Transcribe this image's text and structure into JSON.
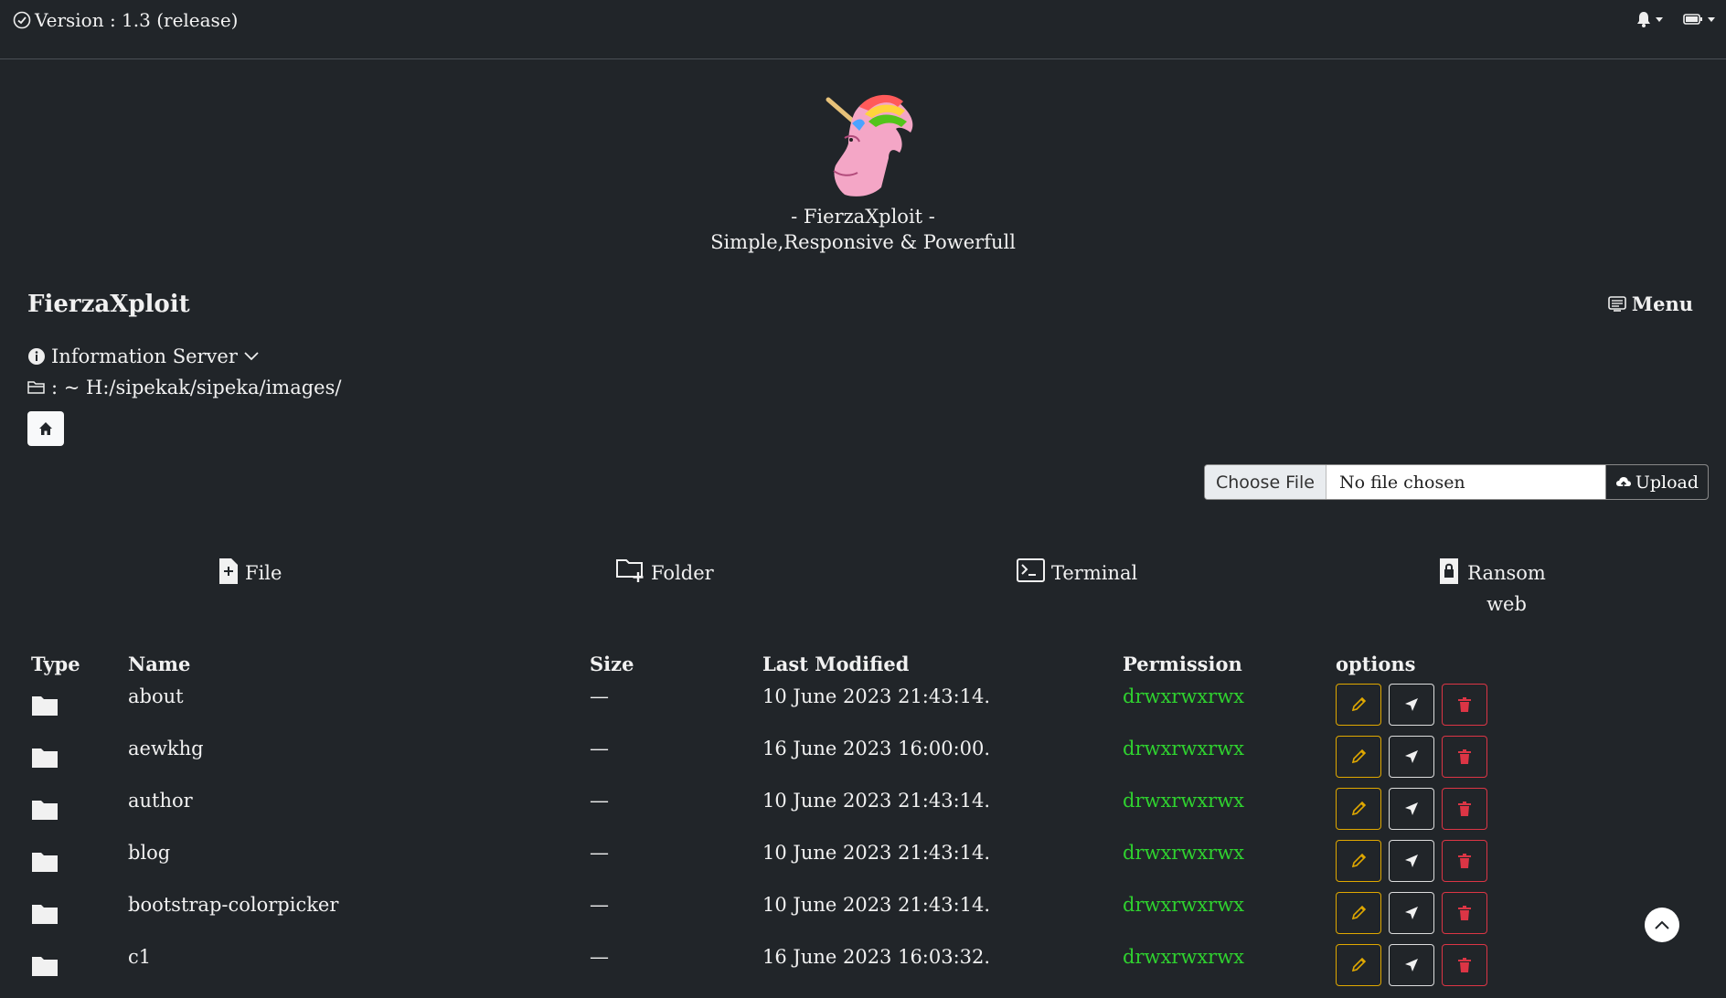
{
  "topbar": {
    "version": "Version : 1.3 (release)",
    "icons": [
      "bell-icon",
      "battery-icon"
    ]
  },
  "hero": {
    "line1": "- FierzaXploit -",
    "line2": "Simple,Responsive & Powerfull"
  },
  "brand": "FierzaXploit",
  "menu_label": "Menu",
  "info_label": "Information Server",
  "path_label": ": ~ H:/sipekak/sipeka/images/",
  "upload": {
    "choose_label": "Choose File",
    "no_file": "No file chosen",
    "upload_label": "Upload"
  },
  "actions": [
    {
      "label": "File",
      "icon": "file-plus-icon"
    },
    {
      "label": "Folder",
      "icon": "folder-plus-icon"
    },
    {
      "label": "Terminal",
      "icon": "terminal-icon"
    },
    {
      "label": "Ransom web",
      "icon": "lock-file-icon"
    }
  ],
  "table": {
    "headers": {
      "type": "Type",
      "name": "Name",
      "size": "Size",
      "modified": "Last Modified",
      "permission": "Permission",
      "options": "options"
    },
    "rows": [
      {
        "name": "about",
        "size": "—",
        "modified": "10 June 2023 21:43:14.",
        "permission": "drwxrwxrwx"
      },
      {
        "name": "aewkhg",
        "size": "—",
        "modified": "16 June 2023 16:00:00.",
        "permission": "drwxrwxrwx"
      },
      {
        "name": "author",
        "size": "—",
        "modified": "10 June 2023 21:43:14.",
        "permission": "drwxrwxrwx"
      },
      {
        "name": "blog",
        "size": "—",
        "modified": "10 June 2023 21:43:14.",
        "permission": "drwxrwxrwx"
      },
      {
        "name": "bootstrap-colorpicker",
        "size": "—",
        "modified": "10 June 2023 21:43:14.",
        "permission": "drwxrwxrwx"
      },
      {
        "name": "c1",
        "size": "—",
        "modified": "16 June 2023 16:03:32.",
        "permission": "drwxrwxrwx"
      }
    ]
  },
  "colors": {
    "background": "#212529",
    "permission": "#2fd12f",
    "edit": "#e0a800",
    "delete": "#dc3545"
  }
}
